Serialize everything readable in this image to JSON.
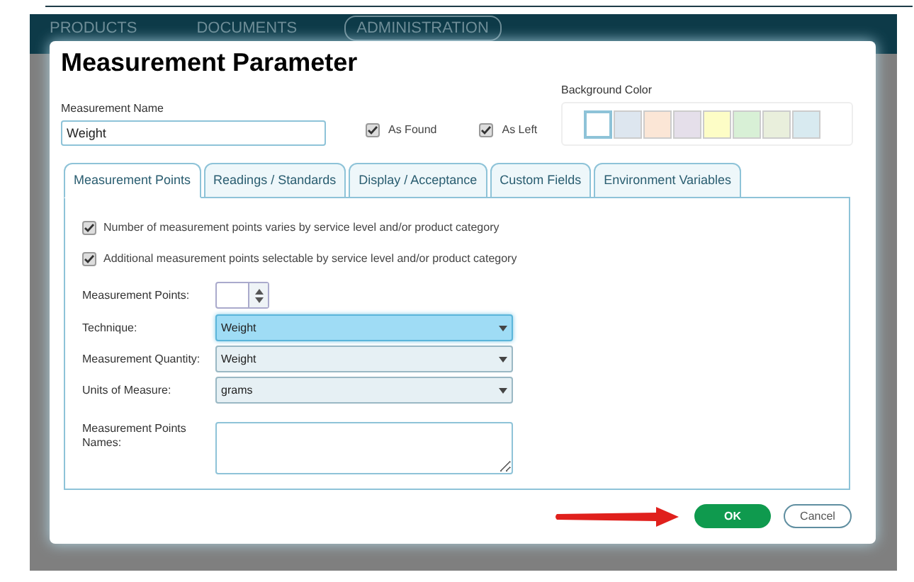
{
  "app_nav": [
    {
      "label": "PRODUCTS",
      "selected": false
    },
    {
      "label": "DOCUMENTS",
      "selected": false
    },
    {
      "label": "ADMINISTRATION",
      "selected": true
    }
  ],
  "dialog": {
    "title": "Measurement Parameter",
    "name_field": {
      "label": "Measurement Name",
      "value": "Weight"
    },
    "flags": [
      {
        "label": "As Found",
        "checked": true
      },
      {
        "label": "As Left",
        "checked": true
      }
    ],
    "background_color": {
      "label": "Background Color",
      "swatches": [
        {
          "color": "#ffffff",
          "selected": true
        },
        {
          "color": "#dde6ef",
          "selected": false
        },
        {
          "color": "#fbe6d6",
          "selected": false
        },
        {
          "color": "#e5dfea",
          "selected": false
        },
        {
          "color": "#fdfdc6",
          "selected": false
        },
        {
          "color": "#d8f0d6",
          "selected": false
        },
        {
          "color": "#e9efdc",
          "selected": false
        },
        {
          "color": "#d8eaf0",
          "selected": false
        }
      ]
    },
    "tabs": [
      {
        "label": "Measurement Points",
        "selected": true
      },
      {
        "label": "Readings / Standards",
        "selected": false
      },
      {
        "label": "Display / Acceptance",
        "selected": false
      },
      {
        "label": "Custom Fields",
        "selected": false
      },
      {
        "label": "Environment Variables",
        "selected": false
      }
    ],
    "options": [
      {
        "label": "Number of measurement points varies by service level and/or product category",
        "checked": true
      },
      {
        "label": "Additional measurement points selectable by service level and/or product category",
        "checked": true
      }
    ],
    "fields": [
      {
        "kind": "spinner",
        "label": "Measurement Points:"
      },
      {
        "kind": "select",
        "label": "Technique:",
        "value": "Weight",
        "focused": true
      },
      {
        "kind": "select",
        "label": "Measurement Quantity:",
        "value": "Weight",
        "focused": false
      },
      {
        "kind": "select",
        "label": "Units of Measure:",
        "value": "grams",
        "focused": false
      },
      {
        "kind": "textarea",
        "label": "Measurement Points Names:"
      }
    ],
    "buttons": [
      {
        "label": "OK",
        "kind": "primary"
      },
      {
        "label": "Cancel",
        "kind": "secondary"
      }
    ]
  }
}
